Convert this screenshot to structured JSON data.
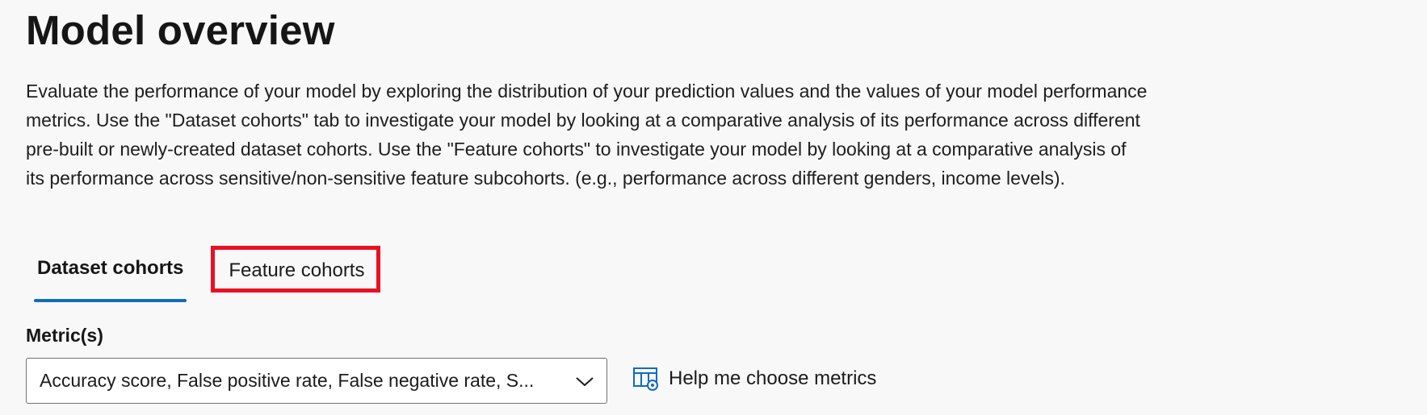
{
  "page": {
    "title": "Model overview",
    "description": "Evaluate the performance of your model by exploring the distribution of your prediction values and the values of your model performance metrics. Use the \"Dataset cohorts\" tab to investigate your model by looking at a comparative analysis of its performance across different pre-built or newly-created dataset cohorts. Use the \"Feature cohorts\" to investigate your model by looking at a comparative analysis of its performance across sensitive/non-sensitive feature subcohorts. (e.g., performance across different genders, income levels)."
  },
  "tabs": [
    {
      "label": "Dataset cohorts",
      "selected": true
    },
    {
      "label": "Feature cohorts",
      "selected": false,
      "highlighted": true
    }
  ],
  "metrics": {
    "label": "Metric(s)",
    "selected_value": "Accuracy score, False positive rate, False negative rate, S...",
    "help_link": "Help me choose metrics"
  },
  "colors": {
    "accent": "#0f6cbd",
    "highlight_border": "#e81123",
    "background": "#f8f8f8"
  },
  "icons": {
    "dropdown": "chevron-down-icon",
    "help": "table-settings-icon"
  }
}
